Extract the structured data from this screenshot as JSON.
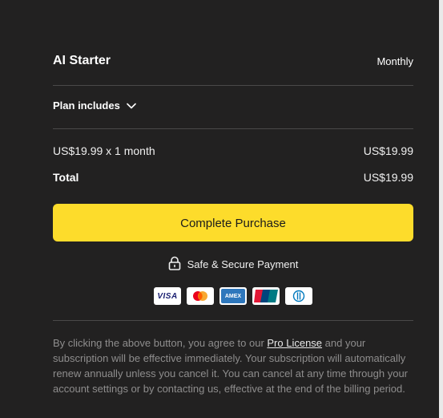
{
  "plan": {
    "name": "AI Starter",
    "billing": "Monthly",
    "includes_label": "Plan includes"
  },
  "summary": {
    "line_label": "US$19.99 x 1 month",
    "line_amount": "US$19.99",
    "total_label": "Total",
    "total_amount": "US$19.99"
  },
  "cta_label": "Complete Purchase",
  "secure_label": "Safe & Secure Payment",
  "payment_methods": [
    {
      "icon": "visa-icon",
      "text": "VISA",
      "color": "#1a1f71"
    },
    {
      "icon": "mastercard-icon",
      "colors": [
        "#eb001b",
        "#f79e1b"
      ]
    },
    {
      "icon": "amex-icon",
      "text": "AMEX",
      "color": "#2e77bc"
    },
    {
      "icon": "unionpay-icon",
      "text": "UnionPay",
      "colors": [
        "#e21836",
        "#00447c",
        "#007b84"
      ]
    },
    {
      "icon": "diners-club-icon",
      "color": "#0079be"
    }
  ],
  "legal": {
    "before": "By clicking the above button, you agree to our ",
    "link": "Pro License",
    "after": " and your subscription will be effective immediately. Your subscription will automatically renew annually unless you cancel it. You can cancel at any time through your account settings or by contacting us, effective at the end of the billing period."
  },
  "colors": {
    "background": "#222121",
    "accent": "#fddc2b",
    "divider": "#4a4949",
    "muted_text": "#8e8d8d"
  }
}
